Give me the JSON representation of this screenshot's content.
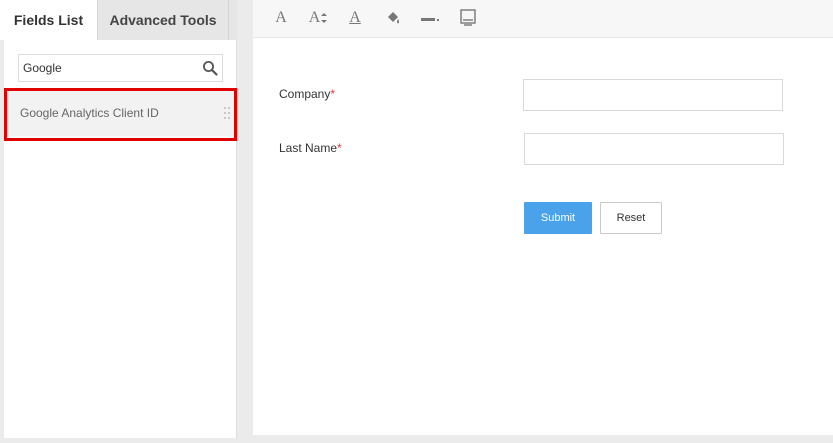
{
  "left_panel": {
    "tabs": [
      {
        "label": "Fields List",
        "active": true
      },
      {
        "label": "Advanced Tools",
        "active": false
      }
    ],
    "search": {
      "value": "Google",
      "icon": "search-icon"
    },
    "fields": [
      {
        "label": "Google Analytics Client ID",
        "highlighted": true
      }
    ]
  },
  "toolbar": {
    "items": [
      {
        "name": "font-family-icon",
        "glyph": "A"
      },
      {
        "name": "font-size-icon",
        "glyph": "A"
      },
      {
        "name": "font-color-icon",
        "glyph": "A"
      },
      {
        "name": "fill-color-icon",
        "glyph": ""
      },
      {
        "name": "border-style-icon",
        "glyph": ""
      },
      {
        "name": "layout-icon",
        "glyph": ""
      }
    ]
  },
  "form": {
    "fields": [
      {
        "label": "Company",
        "required_mark": "*",
        "value": ""
      },
      {
        "label": "Last Name",
        "required_mark": "*",
        "value": ""
      }
    ],
    "submit_label": "Submit",
    "reset_label": "Reset"
  },
  "colors": {
    "accent": "#4aa3ea",
    "highlight": "#e00000",
    "required": "#e53935"
  }
}
